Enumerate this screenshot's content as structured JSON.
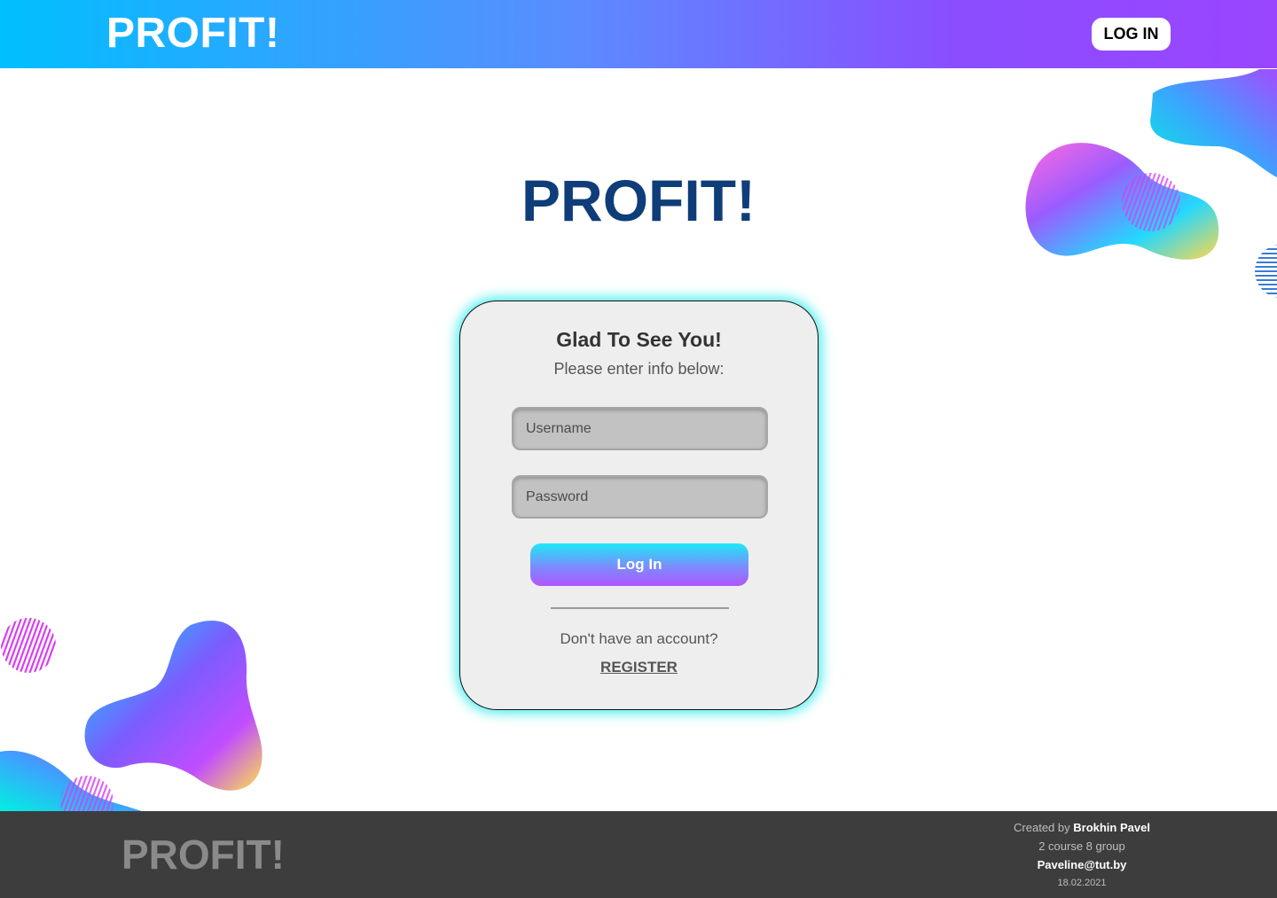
{
  "header": {
    "logo": "PROFIT!",
    "login_button": "LOG IN"
  },
  "main": {
    "title": "PROFIT!"
  },
  "login_card": {
    "heading": "Glad To See You!",
    "subheading": "Please enter info below:",
    "username_placeholder": "Username",
    "password_placeholder": "Password",
    "submit_label": "Log In",
    "no_account_text": "Don't have an account?",
    "register_label": "REGISTER"
  },
  "footer": {
    "logo": "PROFIT!",
    "created_by_prefix": "Created by",
    "author": "Brokhin Pavel",
    "group": "2 course 8 group",
    "email": "Paveline@tut.by",
    "date": "18.02.2021"
  },
  "colors": {
    "header_gradient_start": "#00bfff",
    "header_gradient_end": "#9a45ff",
    "title_blue": "#0e3d7a",
    "card_background": "#eeeeee",
    "card_glow": "#00e6e6",
    "footer_background": "#3d3d3d"
  }
}
